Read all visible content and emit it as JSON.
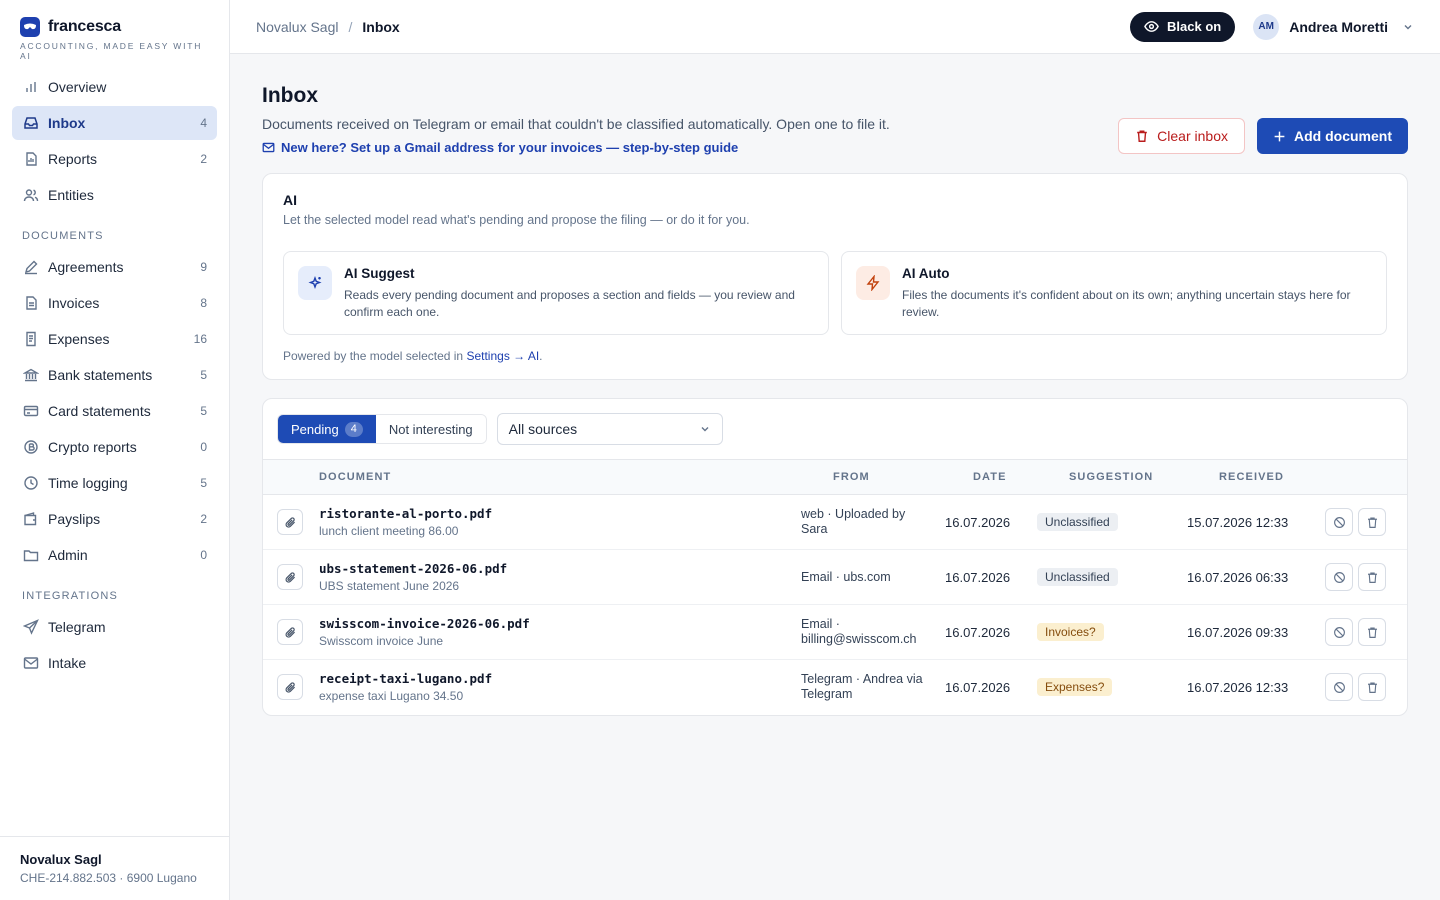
{
  "brand": {
    "name": "francesca",
    "tagline": "ACCOUNTING, MADE EASY WITH AI",
    "logo_icon": "mask-icon"
  },
  "sidebar": {
    "top_items": [
      {
        "label": "Overview",
        "icon": "chart-icon",
        "count": ""
      },
      {
        "label": "Inbox",
        "icon": "inbox-icon",
        "count": "4",
        "active": true
      },
      {
        "label": "Reports",
        "icon": "report-icon",
        "count": "2"
      },
      {
        "label": "Entities",
        "icon": "users-icon",
        "count": ""
      }
    ],
    "documents_heading": "DOCUMENTS",
    "document_items": [
      {
        "label": "Agreements",
        "icon": "pen-icon",
        "count": "9"
      },
      {
        "label": "Invoices",
        "icon": "file-icon",
        "count": "8"
      },
      {
        "label": "Expenses",
        "icon": "receipt-icon",
        "count": "16"
      },
      {
        "label": "Bank statements",
        "icon": "bank-icon",
        "count": "5"
      },
      {
        "label": "Card statements",
        "icon": "card-icon",
        "count": "5"
      },
      {
        "label": "Crypto reports",
        "icon": "coin-icon",
        "count": "0"
      },
      {
        "label": "Time logging",
        "icon": "clock-icon",
        "count": "5"
      },
      {
        "label": "Payslips",
        "icon": "wallet-icon",
        "count": "2"
      },
      {
        "label": "Admin",
        "icon": "folder-icon",
        "count": "0"
      }
    ],
    "integrations_heading": "INTEGRATIONS",
    "integration_items": [
      {
        "label": "Telegram",
        "icon": "send-icon"
      },
      {
        "label": "Intake",
        "icon": "mail-icon"
      }
    ],
    "footer": {
      "company": "Novalux Sagl",
      "meta": "CHE-214.882.503 · 6900 Lugano"
    }
  },
  "topbar": {
    "breadcrumb": [
      "Novalux Sagl",
      "Inbox"
    ],
    "toggle_label": "Black on",
    "user": {
      "initials": "AM",
      "name": "Andrea Moretti"
    }
  },
  "page": {
    "title": "Inbox",
    "description": "Documents received on Telegram or email that couldn't be classified automatically. Open one to file it.",
    "guide_link": "New here? Set up a Gmail address for your invoices — step-by-step guide",
    "clear_label": "Clear inbox",
    "add_label": "Add document"
  },
  "ai": {
    "title": "AI",
    "subtitle": "Let the selected model read what's pending and propose the filing — or do it for you.",
    "suggest": {
      "title": "AI Suggest",
      "desc": "Reads every pending document and proposes a section and fields — you review and confirm each one."
    },
    "auto": {
      "title": "AI Auto",
      "desc": "Files the documents it's confident about on its own; anything uncertain stays here for review."
    },
    "powered_prefix": "Powered by the model selected in",
    "powered_link": "Settings → AI",
    "powered_suffix": "."
  },
  "filters": {
    "pending_label": "Pending",
    "pending_count": "4",
    "not_interesting_label": "Not interesting",
    "source_value": "All sources"
  },
  "table": {
    "columns": {
      "document": "DOCUMENT",
      "from": "FROM",
      "date": "DATE",
      "suggestion": "SUGGESTION",
      "received": "RECEIVED"
    },
    "rows": [
      {
        "file": "ristorante-al-porto.pdf",
        "note": "lunch client meeting 86.00",
        "from1": "web · Uploaded by",
        "from2": "Sara",
        "date": "16.07.2026",
        "suggestion": "Unclassified",
        "tone": "gray",
        "received": "15.07.2026 12:33"
      },
      {
        "file": "ubs-statement-2026-06.pdf",
        "note": "UBS statement June 2026",
        "from1": "Email · ubs.com",
        "from2": "",
        "date": "16.07.2026",
        "suggestion": "Unclassified",
        "tone": "gray",
        "received": "16.07.2026 06:33"
      },
      {
        "file": "swisscom-invoice-2026-06.pdf",
        "note": "Swisscom invoice June",
        "from1": "Email ·",
        "from2": "billing@swisscom.ch",
        "date": "16.07.2026",
        "suggestion": "Invoices?",
        "tone": "amber",
        "received": "16.07.2026 09:33"
      },
      {
        "file": "receipt-taxi-lugano.pdf",
        "note": "expense taxi Lugano 34.50",
        "from1": "Telegram · Andrea via",
        "from2": "Telegram",
        "date": "16.07.2026",
        "suggestion": "Expenses?",
        "tone": "amber",
        "received": "16.07.2026 12:33"
      }
    ]
  },
  "colors": {
    "accent": "#1e4bb5",
    "danger": "#b91c1c",
    "active_bg": "#dde6f7"
  }
}
